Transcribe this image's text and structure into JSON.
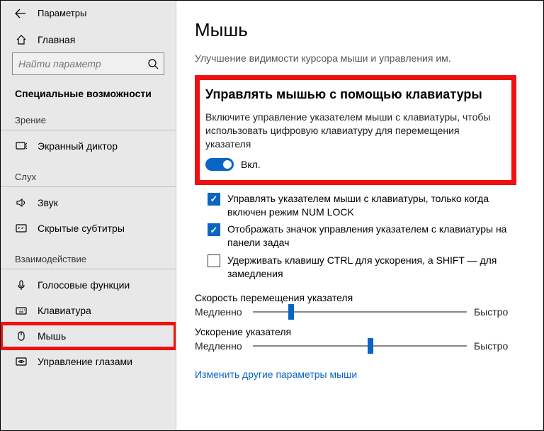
{
  "header": {
    "title": "Параметры"
  },
  "sidebar": {
    "home": "Главная",
    "search_placeholder": "Найти параметр",
    "heading": "Специальные возможности",
    "groups": {
      "vision": "Зрение",
      "hearing": "Слух",
      "interaction": "Взаимодействие"
    },
    "items": {
      "narrator": "Экранный диктор",
      "sound": "Звук",
      "captions": "Скрытые субтитры",
      "speech": "Голосовые функции",
      "keyboard": "Клавиатура",
      "mouse": "Мышь",
      "eye": "Управление глазами"
    }
  },
  "main": {
    "title": "Мышь",
    "subtitle": "Улучшение видимости курсора мыши и управления им.",
    "section": {
      "heading": "Управлять мышью с помощью клавиатуры",
      "desc": "Включите управление указателем мыши с клавиатуры, чтобы использовать цифровую клавиатуру для перемещения указателя",
      "toggle_label": "Вкл."
    },
    "checks": {
      "numlock": "Управлять указателем мыши с клавиатуры, только когда включен режим NUM LOCK",
      "taskbar": "Отображать значок управления указателем с клавиатуры на панели задач",
      "ctrl": "Удерживать клавишу CTRL для ускорения, а SHIFT — для замедления"
    },
    "sliders": {
      "speed_label": "Скорость перемещения указателя",
      "accel_label": "Ускорение указателя",
      "slow": "Медленно",
      "fast": "Быстро"
    },
    "link": "Изменить другие параметры мыши"
  }
}
